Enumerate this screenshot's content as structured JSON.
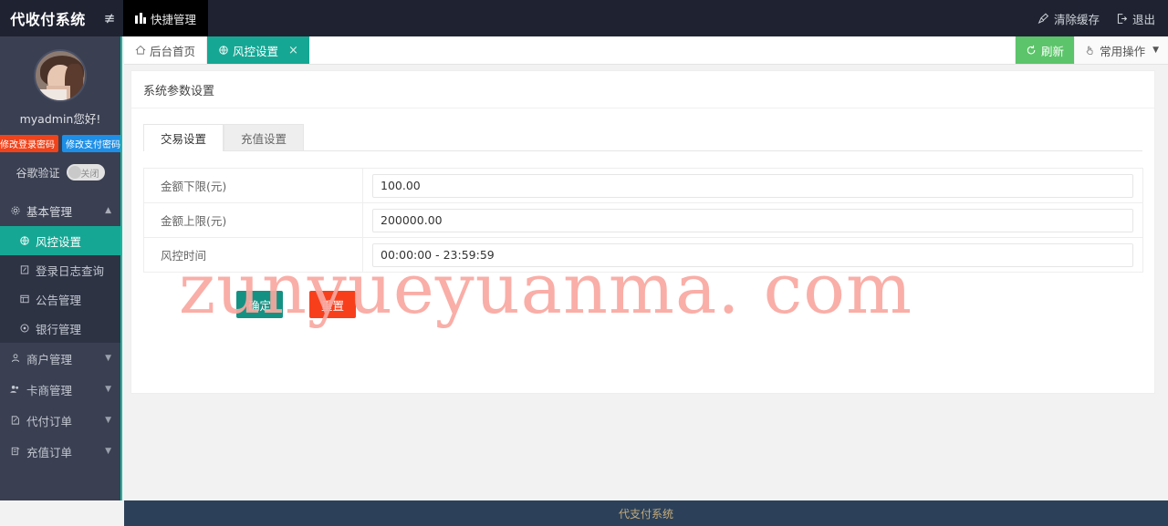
{
  "header": {
    "brand": "代收付系统",
    "collapse_icon": "menu-collapse-icon",
    "quick_item": "快捷管理",
    "clear_cache": "清除缓存",
    "logout": "退出"
  },
  "sidebar": {
    "username": "myadmin您好!",
    "change_login_pw": "修改登录密码",
    "change_pay_pw": "修改支付密码",
    "ga_label": "谷歌验证",
    "ga_state": "关闭",
    "groups": [
      {
        "label": "基本管理",
        "icon": "gear-icon",
        "expanded": true,
        "items": [
          {
            "label": "风控设置",
            "icon": "globe-icon",
            "active": true
          },
          {
            "label": "登录日志查询",
            "icon": "log-icon",
            "active": false
          },
          {
            "label": "公告管理",
            "icon": "announcement-icon",
            "active": false
          },
          {
            "label": "银行管理",
            "icon": "bank-icon",
            "active": false
          }
        ]
      }
    ],
    "top_items": [
      {
        "label": "商户管理",
        "icon": "user-icon"
      },
      {
        "label": "卡商管理",
        "icon": "users-icon"
      },
      {
        "label": "代付订单",
        "icon": "order-icon"
      },
      {
        "label": "充值订单",
        "icon": "recharge-icon"
      }
    ]
  },
  "tabbar": {
    "tabs": [
      {
        "label": "后台首页",
        "icon": "home-icon",
        "active": false,
        "closable": false
      },
      {
        "label": "风控设置",
        "icon": "globe-icon",
        "active": true,
        "closable": true
      }
    ],
    "close_glyph": "×",
    "refresh": "刷新",
    "operations": "常用操作"
  },
  "main": {
    "panel_title": "系统参数设置",
    "form_tabs": [
      {
        "label": "交易设置",
        "active": true
      },
      {
        "label": "充值设置",
        "active": false
      }
    ],
    "fields": [
      {
        "label": "金额下限(元)",
        "value": "100.00"
      },
      {
        "label": "金额上限(元)",
        "value": "200000.00"
      },
      {
        "label": "风控时间",
        "value": "00:00:00 - 23:59:59"
      }
    ],
    "confirm_button": "确定",
    "reset_button": "重置"
  },
  "watermark": "zunyueyuanma. com",
  "footer": {
    "text": "代支付系统"
  },
  "colors": {
    "header_bg": "#1f2331",
    "sidebar_bg": "#3a3f51",
    "accent_teal": "#16a794",
    "sidebar_border": "#16baa0",
    "refresh_green": "#5cc46a",
    "confirm": "#159183",
    "reset": "#f83f1c",
    "login_pw": "#f0431b",
    "pay_pw": "#1e8fe6",
    "footer_bg": "#2c4159",
    "footer_text": "#c4ab7d",
    "watermark": "#f9a8a0"
  }
}
